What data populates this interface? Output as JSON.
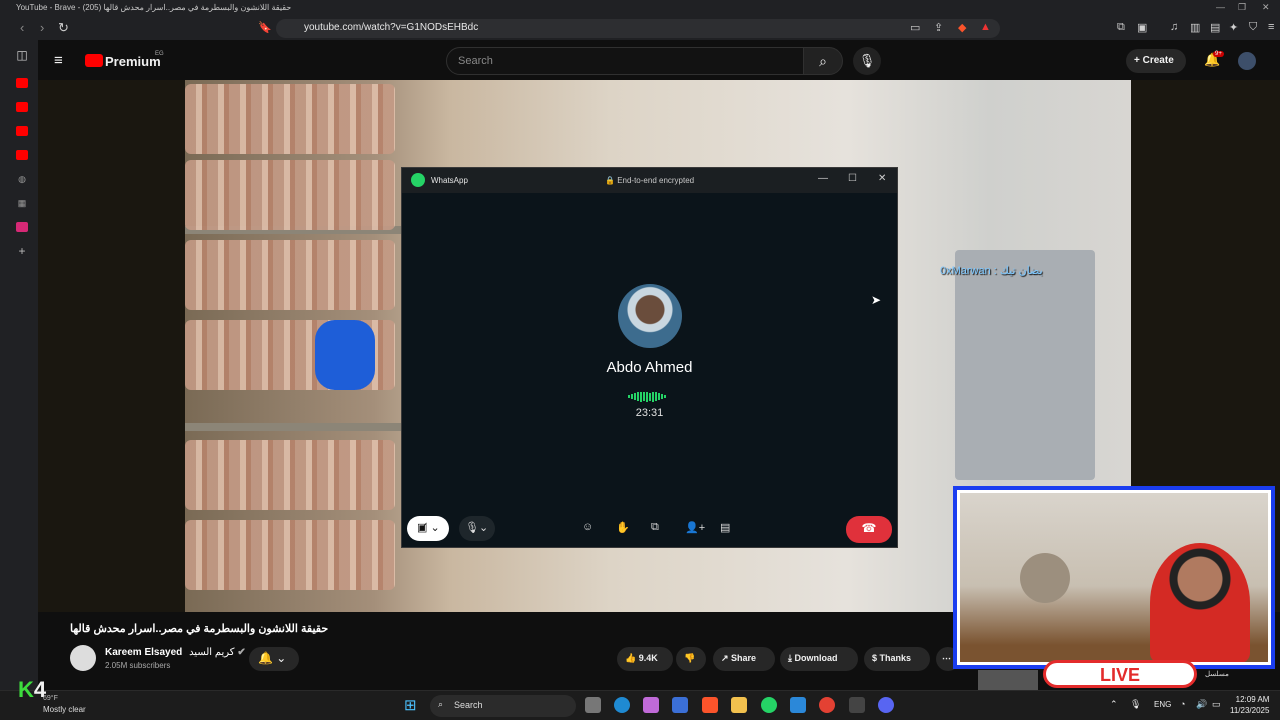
{
  "browser": {
    "window_title": "YouTube - Brave - حقيقة اللانشون والبسطرمة في مصر..اسرار محدش قالها (205)",
    "url": "youtube.com/watch?v=G1NODsEHBdc"
  },
  "youtube": {
    "logo_label": "Premium",
    "logo_region": "EG",
    "search_placeholder": "Search",
    "create_label": "Create",
    "notif_badge": "9+",
    "video_title": "حقيقة اللانشون والبسطرمة في مصر..اسرار محدش قالها",
    "channel_name": "Kareem Elsayed",
    "channel_name_ar": "كريم السيد",
    "subscribers": "2.05M subscribers",
    "like_count": "9.4K",
    "share_label": "Share",
    "download_label": "Download",
    "thanks_label": "Thanks"
  },
  "whatsapp": {
    "app_name": "WhatsApp",
    "encryption": "End-to-end encrypted",
    "callee_name": "Abdo Ahmed",
    "call_duration": "23:31"
  },
  "stream_overlay": {
    "chat_message": "بضان تيك : 0xMarwan",
    "live_label": "LIVE",
    "ticker_text": "مسلسل"
  },
  "taskbar": {
    "stream_tag": "4",
    "temperature": "69°F",
    "weather": "Mostly clear",
    "search_label": "Search",
    "language": "ENG",
    "time": "12:09 AM",
    "date": "11/23/2025"
  },
  "colors": {
    "youtube_red": "#ff0000",
    "whatsapp_green": "#25d366",
    "end_call_red": "#e0313b",
    "webcam_border": "#1a3df0"
  }
}
